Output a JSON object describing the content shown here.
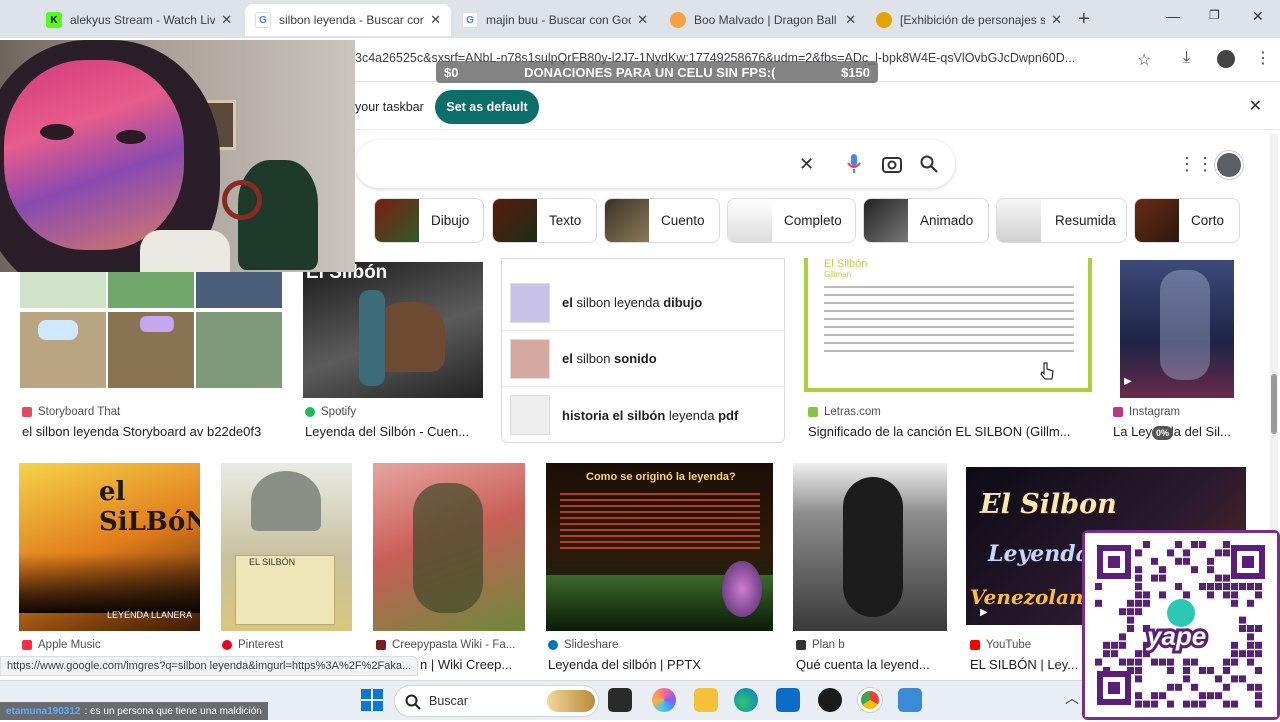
{
  "tabs": [
    {
      "title": "alekyus Stream - Watch Live",
      "fav_color": "#53fc18",
      "fav_letter": "K"
    },
    {
      "title": "silbon leyenda - Buscar con G",
      "fav_color": "#4285f4",
      "fav_letter": "G"
    },
    {
      "title": "majin buu - Buscar con Googl",
      "fav_color": "#4285f4",
      "fav_letter": "G"
    },
    {
      "title": "Boo Malvado | Dragon Ball W",
      "fav_color": "#f4a340",
      "fav_letter": ""
    },
    {
      "title": "[Exhibición de personajes se",
      "fav_color": "#e8a200",
      "fav_letter": ""
    }
  ],
  "address": {
    "url": "3c4a26525c&sxsrf=ANbL-n78s1sulpQrFB80y-l2J7-1NydKw:17749258676&udm=2&fbs=ADc_l-bpk8W4E-qsVlOvbGJcDwpn60D..."
  },
  "donation": {
    "left": "$0",
    "label": "DONACIONES PARA UN CELU SIN FPS:(",
    "right": "$150",
    "progress": 0.0
  },
  "infobar": {
    "text": "your taskbar",
    "button": "Set as default"
  },
  "filters": [
    "Dibujo",
    "Texto",
    "Cuento",
    "Completo",
    "Animado",
    "Resumida",
    "Corto"
  ],
  "suggestions": [
    {
      "pre": "el",
      "mid": " silbon leyenda ",
      "post": "dibujo"
    },
    {
      "pre": "el",
      "mid": " silbon ",
      "post": "sonido"
    },
    {
      "pre": "historia el silbón",
      "mid": " leyenda ",
      "post": "pdf"
    }
  ],
  "row1": [
    {
      "source": "Storyboard That",
      "caption": "el silbon leyenda Storyboard av b22de0f3",
      "color": "#e04a5c"
    },
    {
      "source": "Spotify",
      "caption": "Leyenda del Silbón - Cuen...",
      "color": "#1db954",
      "img_title": "El Silbón"
    },
    {
      "source": "Letras.com",
      "caption": "Significado de la canción EL SILBON (Gillm...",
      "color": "#8ac43f",
      "img_title": "El Silbón",
      "img_sub": "Gillman"
    },
    {
      "source": "Instagram",
      "caption": "La Leyenda del Sil...",
      "color": "#c13584",
      "badge": "0%"
    }
  ],
  "row2": [
    {
      "source": "Apple Music",
      "caption": "",
      "color": "#fa2d48",
      "img_title": "el SiLBóN",
      "img_sub": "LEYENDA LLANERA"
    },
    {
      "source": "Pinterest",
      "caption": "",
      "color": "#e60023",
      "img_title": "EL SILBÓN"
    },
    {
      "source": "Creepypasta Wiki - Fa...",
      "caption": "n | Wiki Creep...",
      "color": "#7a1f1f"
    },
    {
      "source": "Slideshare",
      "caption": "Leyenda del silbón | PPTX",
      "color": "#0077b5",
      "img_title": "Como se originó la leyenda?"
    },
    {
      "source": "Plan b",
      "caption": "Qué cuenta la leyend...",
      "color": "#333333"
    },
    {
      "source": "YouTube",
      "caption": "EL SILBÓN | Ley...",
      "color": "#ff0000",
      "img_title": "El Silbon",
      "img_l2": "Leyenda",
      "img_l3": "Venezolana"
    }
  ],
  "status_url": "https://www.google.com/imgres?q=silbon leyenda&imgurl=https%3A%2F%2Faka...",
  "chat": {
    "user": "etamuna190312",
    "message": ": es un persona que tiene una maldición"
  },
  "taskbar": {
    "search_placeholder": "Buscar"
  },
  "qr": {
    "brand": "yape"
  }
}
